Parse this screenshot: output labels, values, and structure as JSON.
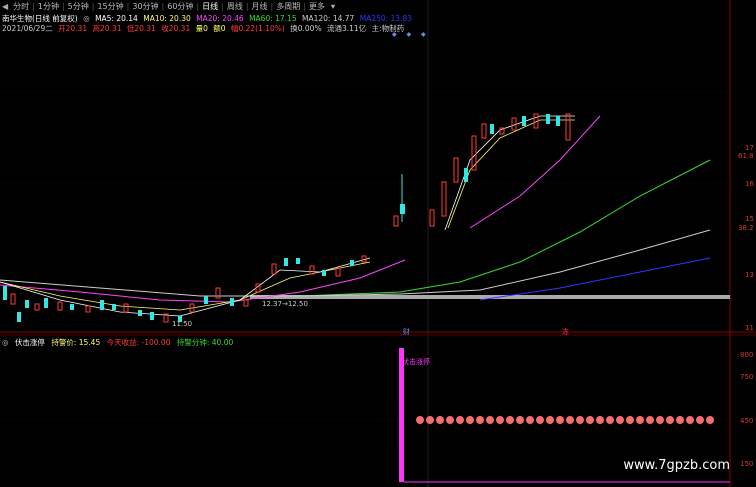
{
  "toolbar": {
    "nav": "◀",
    "tabs": [
      "分时",
      "1分钟",
      "5分钟",
      "15分钟",
      "30分钟",
      "60分钟",
      "日线",
      "周线",
      "月线",
      "多周期",
      "更多"
    ],
    "active": "日线",
    "more_arrow": "▾"
  },
  "info1": {
    "stock": "南华生物(日线 前复权)",
    "icon": "◎",
    "ma5": "MA5: 20.14",
    "ma10": "MA10: 20.30",
    "ma20": "MA20: 20.46",
    "ma60": "MA60: 17.15",
    "ma120": "MA120: 14.77",
    "ma250": "MA250: 13.83"
  },
  "info2": {
    "date": "2021/06/29二",
    "open": "开20.31",
    "high": "高20.31",
    "low": "低20.31",
    "close": "收20.31",
    "volume": "量0",
    "change": "额0",
    "amplitude": "幅0.22(1.10%)",
    "turnover": "换0.00%",
    "float": "流通3.11亿",
    "sector": "主:物制药"
  },
  "indicator": {
    "icon": "◎",
    "name": "伏击涨停",
    "entry": "持警价: 15.45",
    "today": "今天收益: -100.00",
    "minutes": "持警分钟: 40.00"
  },
  "axis": {
    "right": [
      "17",
      "61.8",
      "16",
      "15",
      "38.2",
      "13",
      "11",
      "800",
      "750",
      "450",
      "150"
    ]
  },
  "annotations": {
    "low_label": "11.50",
    "range_label": "12.37→12.50",
    "marker1": "财",
    "marker2": "冻",
    "bar_label": "伏击涨停"
  },
  "watermark": "www.7gpzb.com",
  "colors": {
    "up": "#ff3b3b",
    "down": "#33e6e6",
    "ma5": "#ffffff",
    "ma10": "#ffff66",
    "ma20": "#ff44ff",
    "ma60": "#33dd33",
    "ma120": "#cccccc",
    "ma250": "#3333ff",
    "magenta": "#ff33ff"
  }
}
